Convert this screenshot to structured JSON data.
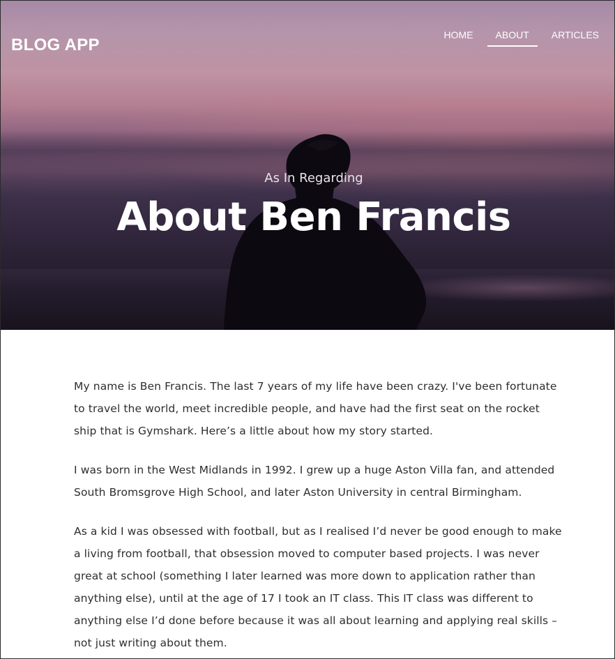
{
  "header": {
    "brand": "BLOG APP",
    "nav": [
      {
        "label": "HOME",
        "active": false
      },
      {
        "label": "ABOUT",
        "active": true
      },
      {
        "label": "ARTICLES",
        "active": false
      }
    ]
  },
  "hero": {
    "subtitle": "As In Regarding",
    "title": "About Ben Francis"
  },
  "content": {
    "paragraphs": [
      "My name is Ben Francis. The last 7 years of my life have been crazy. I've been fortunate to travel the world, meet incredible people, and have had the first seat on the rocket ship that is Gymshark. Here’s a little about how my story started.",
      "I was born in the West Midlands in 1992. I grew up a huge Aston Villa fan, and attended South Bromsgrove High School, and later Aston University in central Birmingham.",
      "As a kid I was obsessed with football, but as I realised I’d never be good enough to make a living from football, that obsession moved to computer based projects. I was never great at school (something I later learned was more down to application rather than anything else), until at the age of 17 I took an IT class. This IT class was different to anything else I’d done before because it was all about learning and applying real skills – not just writing about them."
    ]
  },
  "colors": {
    "accent": "#ffffff",
    "text": "#2e2e2e"
  }
}
